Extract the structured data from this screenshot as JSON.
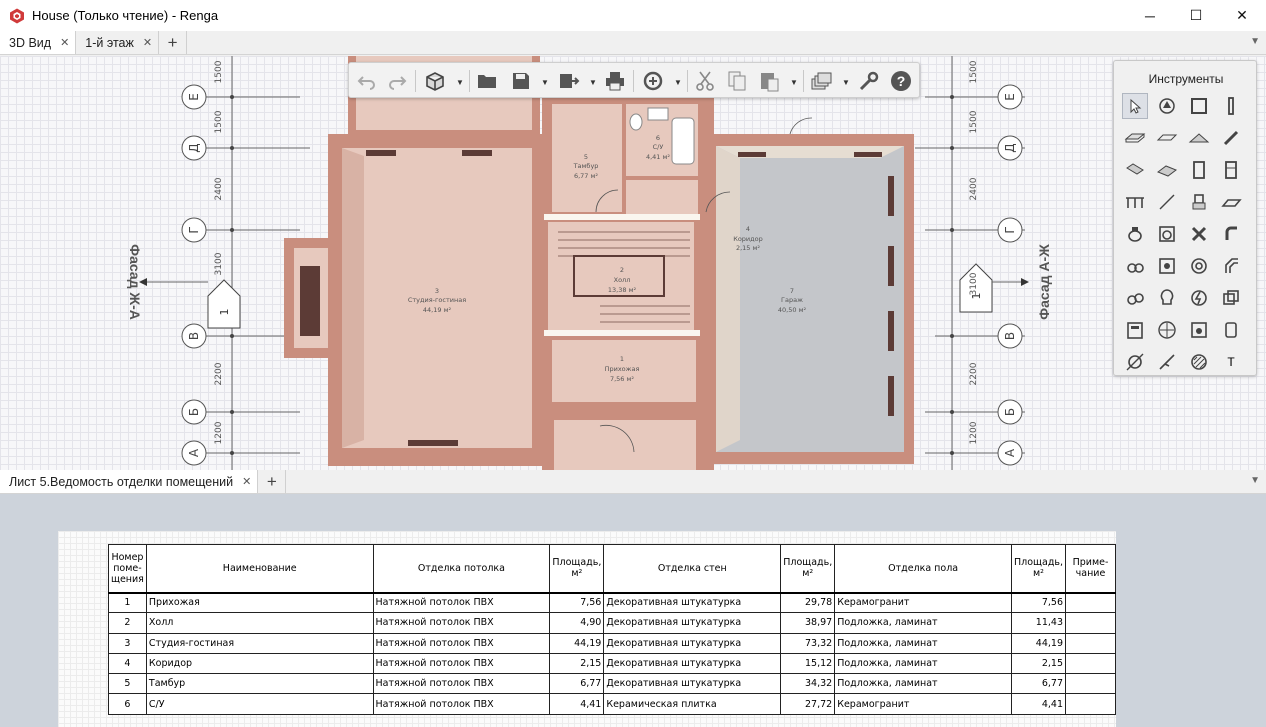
{
  "window": {
    "title": "House (Только чтение) - Renga",
    "minimize": "─",
    "maximize": "☐",
    "close": "✕"
  },
  "view_tabs": [
    {
      "label": "3D Вид",
      "active": true
    },
    {
      "label": "1-й этаж",
      "active": false
    }
  ],
  "sheet_tabs": [
    {
      "label": "Лист 5.Ведомость отделки помещений",
      "active": true
    }
  ],
  "tab_add": "+",
  "tab_close": "✕",
  "tab_menu": "▼",
  "toolbar": {
    "buttons": [
      "undo-icon",
      "redo-icon",
      "3d-cube-icon",
      "open-folder-icon",
      "save-icon",
      "export-icon",
      "print-icon",
      "sync-icon",
      "cut-icon",
      "copy-icon",
      "paste-icon",
      "layers-icon",
      "settings-wrench-icon",
      "help-icon"
    ],
    "help": "?"
  },
  "tools_panel": {
    "title": "Инструменты",
    "text_tool": "T"
  },
  "plan": {
    "axes_left": [
      "Е",
      "Д",
      "Г",
      "В",
      "Б",
      "А"
    ],
    "axes_right": [
      "Е",
      "Д",
      "Г",
      "В",
      "Б",
      "А"
    ],
    "dims_left": [
      "1500",
      "1500",
      "2400",
      "3100",
      "2200",
      "1200"
    ],
    "dims_right": [
      "1500",
      "1500",
      "2400",
      "3100",
      "2200",
      "1200"
    ],
    "facade_left": "Фасад Ж-А",
    "facade_right": "Фасад А-Ж",
    "marker": "1",
    "rooms": [
      {
        "num": "3",
        "name": "Студия-гостиная",
        "area": "44,19 м²"
      },
      {
        "num": "5",
        "name": "Тамбур",
        "area": "6,77 м²"
      },
      {
        "num": "6",
        "name": "С/У",
        "area": "4,41 м²"
      },
      {
        "num": "4",
        "name": "Коридор",
        "area": "2,15 м²"
      },
      {
        "num": "2",
        "name": "Холл",
        "area": "13,38 м²"
      },
      {
        "num": "7",
        "name": "Гараж",
        "area": "40,50 м²"
      },
      {
        "num": "1",
        "name": "Прихожая",
        "area": "7,56 м²"
      }
    ]
  },
  "schedule": {
    "headers": {
      "num_l1": "Номер",
      "num_l2": "поме-",
      "num_l3": "щения",
      "name": "Наименование",
      "ceiling": "Отделка потолка",
      "area_l1": "Площадь,",
      "area_l2": "м²",
      "walls": "Отделка стен",
      "floor": "Отделка пола",
      "note_l1": "Приме-",
      "note_l2": "чание"
    },
    "rows": [
      {
        "num": "1",
        "name": "Прихожая",
        "ceiling": "Натяжной потолок ПВХ",
        "ceiling_area": "7,56",
        "walls": "Декоративная штукатурка",
        "walls_area": "29,78",
        "floor": "Керамогранит",
        "floor_area": "7,56",
        "note": ""
      },
      {
        "num": "2",
        "name": "Холл",
        "ceiling": "Натяжной потолок ПВХ",
        "ceiling_area": "4,90",
        "walls": "Декоративная штукатурка",
        "walls_area": "38,97",
        "floor": "Подложка, ламинат",
        "floor_area": "11,43",
        "note": ""
      },
      {
        "num": "3",
        "name": "Студия-гостиная",
        "ceiling": "Натяжной потолок ПВХ",
        "ceiling_area": "44,19",
        "walls": "Декоративная штукатурка",
        "walls_area": "73,32",
        "floor": "Подложка, ламинат",
        "floor_area": "44,19",
        "note": ""
      },
      {
        "num": "4",
        "name": "Коридор",
        "ceiling": "Натяжной потолок ПВХ",
        "ceiling_area": "2,15",
        "walls": "Декоративная штукатурка",
        "walls_area": "15,12",
        "floor": "Подложка, ламинат",
        "floor_area": "2,15",
        "note": ""
      },
      {
        "num": "5",
        "name": "Тамбур",
        "ceiling": "Натяжной потолок ПВХ",
        "ceiling_area": "6,77",
        "walls": "Декоративная штукатурка",
        "walls_area": "34,32",
        "floor": "Подложка, ламинат",
        "floor_area": "6,77",
        "note": ""
      },
      {
        "num": "6",
        "name": "С/У",
        "ceiling": "Натяжной потолок ПВХ",
        "ceiling_area": "4,41",
        "walls": "Керамическая плитка",
        "walls_area": "27,72",
        "floor": "Керамогранит",
        "floor_area": "4,41",
        "note": ""
      }
    ]
  },
  "colors": {
    "wall": "#c98e7e",
    "floor_pink": "#e7c9be",
    "garage_floor": "#cfd0d3",
    "accent_red": "#d03a3a"
  }
}
